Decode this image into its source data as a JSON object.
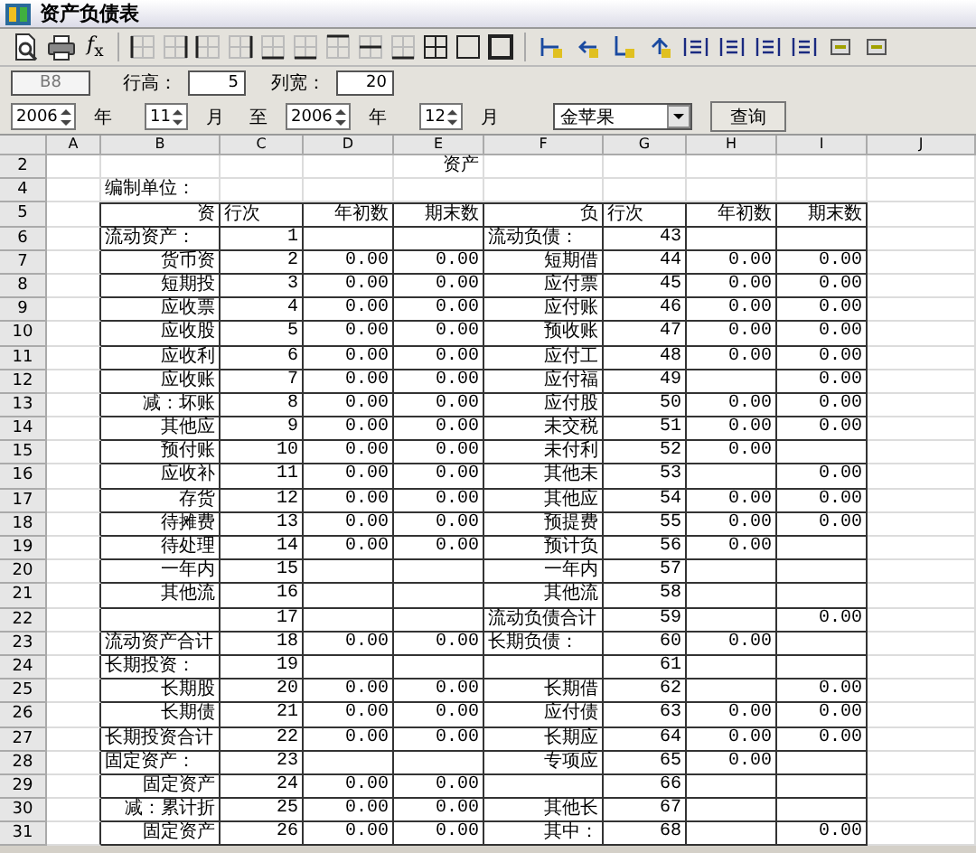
{
  "window": {
    "title": "资产负债表"
  },
  "toolbar": {
    "formula_button": "*f*$_{x}$"
  },
  "cell_ref": {
    "value": "B8",
    "disabled": true
  },
  "row_height": {
    "label": "行高：",
    "value": "5"
  },
  "col_width": {
    "label": "列宽：",
    "value": "20"
  },
  "period": [
    {
      "kind": "spinner",
      "value": "2006"
    },
    {
      "kind": "label",
      "text": "年"
    },
    {
      "kind": "spinner",
      "value": "11"
    },
    {
      "kind": "label",
      "text": "月"
    },
    {
      "kind": "label",
      "text": "至"
    },
    {
      "kind": "spinner",
      "value": "2006"
    },
    {
      "kind": "label",
      "text": "年"
    },
    {
      "kind": "spinner",
      "value": "12"
    },
    {
      "kind": "label",
      "text": "月"
    }
  ],
  "company_select": {
    "value": "金苹果"
  },
  "query_button": "查询",
  "sheet": {
    "columns": [
      "A",
      "B",
      "C",
      "D",
      "E",
      "F",
      "G",
      "H",
      "I",
      "J"
    ],
    "title_row": {
      "header": "2",
      "text": "资产"
    },
    "unit_row": {
      "header": "4",
      "text": "编制单位："
    },
    "header_row": {
      "header": "5",
      "cells": [
        "资",
        "行次",
        "年初数",
        "期末数",
        "负",
        "行次",
        "年初数",
        "期末数"
      ]
    },
    "rows": [
      {
        "header": "6",
        "asset": {
          "kind": "heading",
          "label": "流动资产：",
          "line": "1"
        },
        "liability": {
          "kind": "heading",
          "label": "流动负债：",
          "line": "43"
        }
      },
      {
        "header": "7",
        "asset": {
          "kind": "item",
          "label": "货币资",
          "line": "2",
          "begin": "0.00",
          "end": "0.00"
        },
        "liability": {
          "kind": "item",
          "label": "短期借",
          "line": "44",
          "begin": "0.00",
          "end": "0.00"
        }
      },
      {
        "header": "8",
        "asset": {
          "kind": "item",
          "label": "短期投",
          "line": "3",
          "begin": "0.00",
          "end": "0.00"
        },
        "liability": {
          "kind": "item",
          "label": "应付票",
          "line": "45",
          "begin": "0.00",
          "end": "0.00"
        }
      },
      {
        "header": "9",
        "asset": {
          "kind": "item",
          "label": "应收票",
          "line": "4",
          "begin": "0.00",
          "end": "0.00"
        },
        "liability": {
          "kind": "item",
          "label": "应付账",
          "line": "46",
          "begin": "0.00",
          "end": "0.00"
        }
      },
      {
        "header": "10",
        "asset": {
          "kind": "item",
          "label": "应收股",
          "line": "5",
          "begin": "0.00",
          "end": "0.00"
        },
        "liability": {
          "kind": "item",
          "label": "预收账",
          "line": "47",
          "begin": "0.00",
          "end": "0.00"
        }
      },
      {
        "header": "11",
        "asset": {
          "kind": "item",
          "label": "应收利",
          "line": "6",
          "begin": "0.00",
          "end": "0.00"
        },
        "liability": {
          "kind": "item",
          "label": "应付工",
          "line": "48",
          "begin": "0.00",
          "end": "0.00"
        }
      },
      {
        "header": "12",
        "asset": {
          "kind": "item",
          "label": "应收账",
          "line": "7",
          "begin": "0.00",
          "end": "0.00"
        },
        "liability": {
          "kind": "item",
          "label": "应付福",
          "line": "49",
          "end": "0.00"
        }
      },
      {
        "header": "13",
        "asset": {
          "kind": "item",
          "label": "减：坏账",
          "line": "8",
          "begin": "0.00",
          "end": "0.00"
        },
        "liability": {
          "kind": "item",
          "label": "应付股",
          "line": "50",
          "begin": "0.00",
          "end": "0.00"
        }
      },
      {
        "header": "14",
        "asset": {
          "kind": "item",
          "label": "其他应",
          "line": "9",
          "begin": "0.00",
          "end": "0.00"
        },
        "liability": {
          "kind": "item",
          "label": "未交税",
          "line": "51",
          "begin": "0.00",
          "end": "0.00"
        }
      },
      {
        "header": "15",
        "asset": {
          "kind": "item",
          "label": "预付账",
          "line": "10",
          "begin": "0.00",
          "end": "0.00"
        },
        "liability": {
          "kind": "item",
          "label": "未付利",
          "line": "52",
          "begin": "0.00"
        }
      },
      {
        "header": "16",
        "asset": {
          "kind": "item",
          "label": "应收补",
          "line": "11",
          "begin": "0.00",
          "end": "0.00"
        },
        "liability": {
          "kind": "item",
          "label": "其他未",
          "line": "53",
          "end": "0.00"
        }
      },
      {
        "header": "17",
        "asset": {
          "kind": "item",
          "label": "存货",
          "line": "12",
          "begin": "0.00",
          "end": "0.00"
        },
        "liability": {
          "kind": "item",
          "label": "其他应",
          "line": "54",
          "begin": "0.00",
          "end": "0.00"
        }
      },
      {
        "header": "18",
        "asset": {
          "kind": "item",
          "label": "待摊费",
          "line": "13",
          "begin": "0.00",
          "end": "0.00"
        },
        "liability": {
          "kind": "item",
          "label": "预提费",
          "line": "55",
          "begin": "0.00",
          "end": "0.00"
        }
      },
      {
        "header": "19",
        "asset": {
          "kind": "item",
          "label": "待处理",
          "line": "14",
          "begin": "0.00",
          "end": "0.00"
        },
        "liability": {
          "kind": "item",
          "label": "预计负",
          "line": "56",
          "begin": "0.00"
        }
      },
      {
        "header": "20",
        "asset": {
          "kind": "item",
          "label": "一年内",
          "line": "15"
        },
        "liability": {
          "kind": "item",
          "label": "一年内",
          "line": "57"
        }
      },
      {
        "header": "21",
        "asset": {
          "kind": "item",
          "label": "其他流",
          "line": "16"
        },
        "liability": {
          "kind": "item",
          "label": "其他流",
          "line": "58"
        }
      },
      {
        "header": "22",
        "asset": {
          "kind": "item",
          "line": "17"
        },
        "liability": {
          "kind": "heading",
          "label": "流动负债合计",
          "line": "59",
          "end": "0.00"
        }
      },
      {
        "header": "23",
        "asset": {
          "kind": "heading",
          "label": "流动资产合计",
          "line": "18",
          "begin": "0.00",
          "end": "0.00"
        },
        "liability": {
          "kind": "heading",
          "label": "长期负债：",
          "line": "60",
          "begin": "0.00"
        }
      },
      {
        "header": "24",
        "asset": {
          "kind": "heading",
          "label": "长期投资：",
          "line": "19"
        },
        "liability": {
          "kind": "item",
          "line": "61"
        }
      },
      {
        "header": "25",
        "asset": {
          "kind": "item",
          "label": "长期股",
          "line": "20",
          "begin": "0.00",
          "end": "0.00"
        },
        "liability": {
          "kind": "item",
          "label": "长期借",
          "line": "62",
          "end": "0.00"
        }
      },
      {
        "header": "26",
        "asset": {
          "kind": "item",
          "label": "长期债",
          "line": "21",
          "begin": "0.00",
          "end": "0.00"
        },
        "liability": {
          "kind": "item",
          "label": "应付债",
          "line": "63",
          "begin": "0.00",
          "end": "0.00"
        }
      },
      {
        "header": "27",
        "asset": {
          "kind": "heading",
          "label": "长期投资合计",
          "line": "22",
          "begin": "0.00",
          "end": "0.00"
        },
        "liability": {
          "kind": "item",
          "label": "长期应",
          "line": "64",
          "begin": "0.00",
          "end": "0.00"
        }
      },
      {
        "header": "28",
        "asset": {
          "kind": "heading",
          "label": "固定资产：",
          "line": "23"
        },
        "liability": {
          "kind": "item",
          "label": "专项应",
          "line": "65",
          "begin": "0.00"
        }
      },
      {
        "header": "29",
        "asset": {
          "kind": "item",
          "label": "固定资产",
          "line": "24",
          "begin": "0.00",
          "end": "0.00"
        },
        "liability": {
          "kind": "item",
          "line": "66"
        }
      },
      {
        "header": "30",
        "asset": {
          "kind": "item",
          "label": "减：累计折",
          "line": "25",
          "begin": "0.00",
          "end": "0.00"
        },
        "liability": {
          "kind": "item",
          "label": "其他长",
          "line": "67"
        }
      },
      {
        "header": "31",
        "asset": {
          "kind": "item",
          "label": "固定资产",
          "line": "26",
          "begin": "0.00",
          "end": "0.00"
        },
        "liability": {
          "kind": "item",
          "label": "其中：",
          "line": "68",
          "end": "0.00"
        }
      }
    ]
  }
}
